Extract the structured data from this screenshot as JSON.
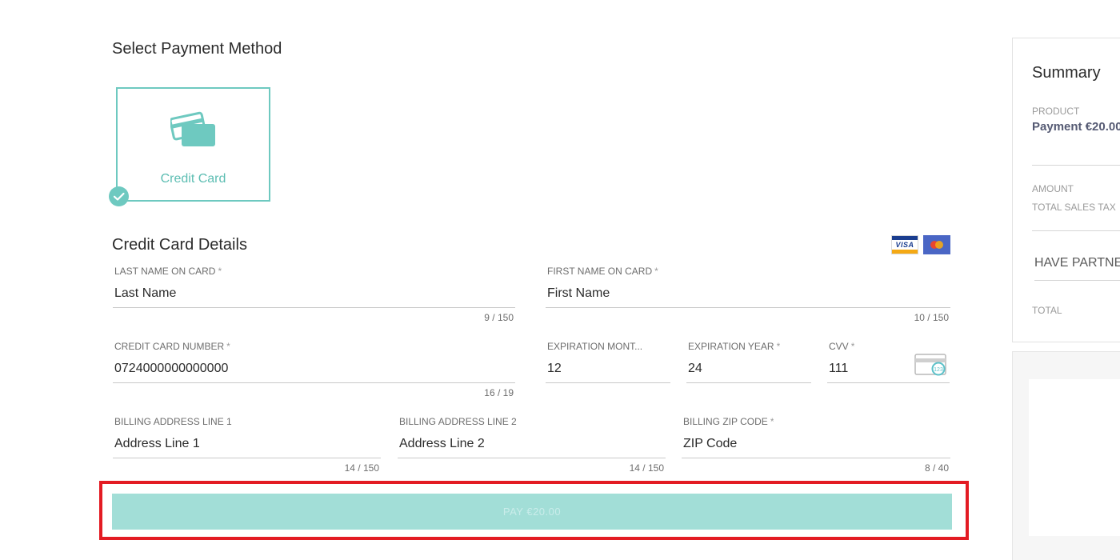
{
  "payment_method": {
    "title": "Select Payment Method",
    "option_label": "Credit Card",
    "selected": true
  },
  "card_details": {
    "title": "Credit Card Details",
    "brands": [
      "visa",
      "mastercard"
    ],
    "brand_visa_text": "VISA",
    "fields": {
      "last_name": {
        "label": "LAST NAME ON CARD",
        "required": "*",
        "value": "Last Name",
        "counter": "9 / 150"
      },
      "first_name": {
        "label": "FIRST NAME ON CARD",
        "required": "*",
        "value": "First Name",
        "counter": "10 / 150"
      },
      "card_number": {
        "label": "CREDIT CARD NUMBER",
        "required": "*",
        "value": "0724000000000000",
        "counter": "16 / 19"
      },
      "exp_month": {
        "label": "EXPIRATION MONT...",
        "required": "",
        "value": "12"
      },
      "exp_year": {
        "label": "EXPIRATION YEAR",
        "required": "*",
        "value": "24"
      },
      "cvv": {
        "label": "CVV",
        "required": "*",
        "value": "111",
        "icon": "cvv-card-icon",
        "icon_text": "123"
      },
      "address1": {
        "label": "BILLING ADDRESS LINE 1",
        "required": "",
        "value": "Address Line 1",
        "counter": "14 / 150"
      },
      "address2": {
        "label": "BILLING ADDRESS LINE 2",
        "required": "",
        "value": "Address Line 2",
        "counter": "14 / 150"
      },
      "zip": {
        "label": "BILLING ZIP CODE",
        "required": "*",
        "value": "ZIP Code",
        "counter": "8 / 40"
      }
    }
  },
  "pay_button": {
    "label": "PAY €20.00",
    "disabled": true,
    "highlight_color": "#e31b23"
  },
  "summary": {
    "title": "Summary",
    "product_label": "PRODUCT",
    "product_value": "Payment €20.00",
    "amount_label": "AMOUNT",
    "tax_label": "TOTAL SALES TAX",
    "partner_label": "HAVE PARTNER",
    "total_label": "TOTAL"
  },
  "colors": {
    "accent": "#6ec9c0",
    "accent_text": "#5cbdb2",
    "button_disabled": "#a2ded7",
    "highlight": "#e31b23"
  }
}
